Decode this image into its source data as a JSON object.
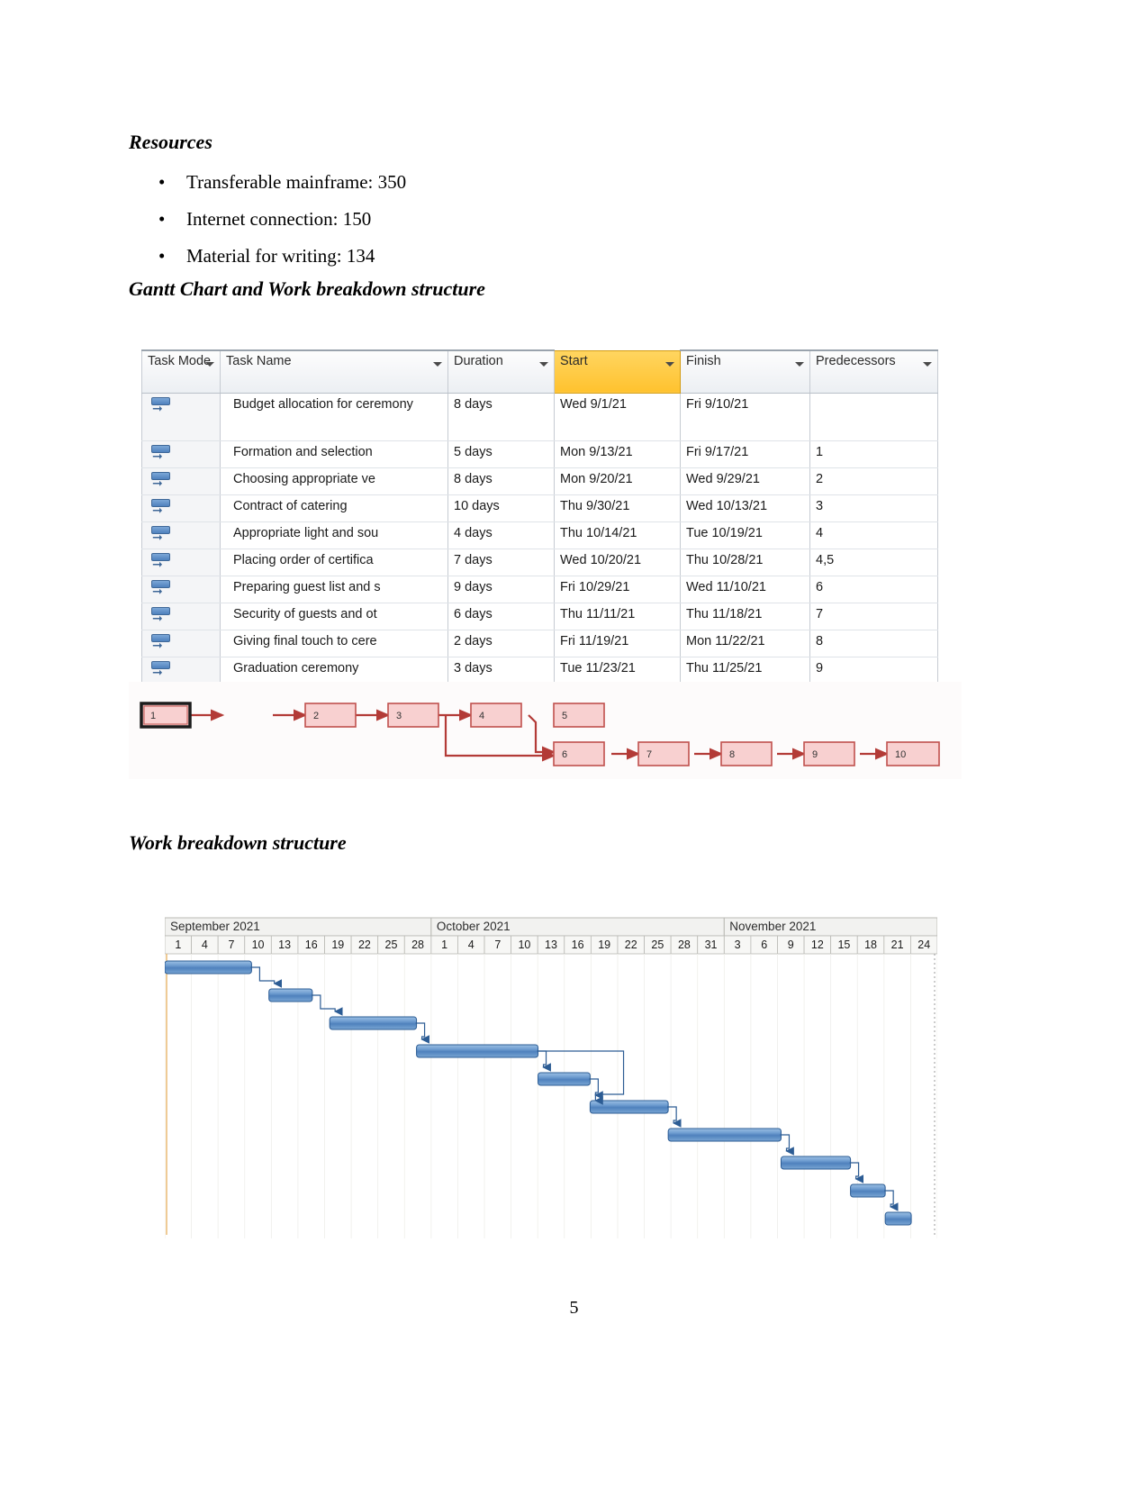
{
  "document": {
    "page_number": "5"
  },
  "sections": {
    "resources_heading": "Resources",
    "gantt_heading": "Gantt Chart and Work breakdown structure",
    "wbs_heading": "Work breakdown structure"
  },
  "resources": {
    "items": [
      "Transferable mainframe: 350",
      "Internet connection: 150",
      "Material for writing: 134"
    ]
  },
  "task_table": {
    "columns": [
      "Task Mode",
      "Task Name",
      "Duration",
      "Start",
      "Finish",
      "Predecessors"
    ],
    "highlighted_column": "Start",
    "highlight_color": "#ffc22e",
    "mode_icon": "auto-schedule-icon",
    "rows": [
      {
        "name": "Budget allocation for ceremony",
        "duration": "8 days",
        "start": "Wed 9/1/21",
        "finish": "Fri 9/10/21",
        "predecessors": ""
      },
      {
        "name": "Formation and selection",
        "duration": "5 days",
        "start": "Mon 9/13/21",
        "finish": "Fri 9/17/21",
        "predecessors": "1"
      },
      {
        "name": "Choosing appropriate ve",
        "duration": "8 days",
        "start": "Mon 9/20/21",
        "finish": "Wed 9/29/21",
        "predecessors": "2"
      },
      {
        "name": "Contract of catering",
        "duration": "10 days",
        "start": "Thu 9/30/21",
        "finish": "Wed 10/13/21",
        "predecessors": "3"
      },
      {
        "name": "Appropriate light and sou",
        "duration": "4 days",
        "start": "Thu 10/14/21",
        "finish": "Tue 10/19/21",
        "predecessors": "4"
      },
      {
        "name": "Placing order of certifica",
        "duration": "7 days",
        "start": "Wed 10/20/21",
        "finish": "Thu 10/28/21",
        "predecessors": "4,5"
      },
      {
        "name": "Preparing guest list and s",
        "duration": "9 days",
        "start": "Fri 10/29/21",
        "finish": "Wed 11/10/21",
        "predecessors": "6"
      },
      {
        "name": "Security of guests and ot",
        "duration": "6 days",
        "start": "Thu 11/11/21",
        "finish": "Thu 11/18/21",
        "predecessors": "7"
      },
      {
        "name": "Giving final touch to cere",
        "duration": "2 days",
        "start": "Fri 11/19/21",
        "finish": "Mon 11/22/21",
        "predecessors": "8"
      },
      {
        "name": "Graduation ceremony",
        "duration": "3 days",
        "start": "Tue 11/23/21",
        "finish": "Thu 11/25/21",
        "predecessors": "9"
      }
    ]
  },
  "network_diagram": {
    "node_fill": "#f8d0d0",
    "node_border": "#c0504d",
    "selected_node": "1",
    "top_row": [
      "1",
      "2",
      "3",
      "4",
      "5"
    ],
    "bottom_row": [
      "6",
      "7",
      "8",
      "9",
      "10"
    ],
    "links": [
      "1>2",
      "2>3",
      "3>4",
      "4>5",
      "4>6",
      "5>6",
      "6>7",
      "7>8",
      "8>9",
      "9>10"
    ]
  },
  "chart_data": {
    "type": "bar",
    "title": "Work breakdown structure",
    "xlabel": "",
    "ylabel": "",
    "orientation": "horizontal-timeline",
    "bar_fill": "#4f81bd",
    "months": [
      {
        "label": "September 2021",
        "ticks": [
          "1",
          "4",
          "7",
          "10",
          "13",
          "16",
          "19",
          "22",
          "25",
          "28"
        ]
      },
      {
        "label": "October 2021",
        "ticks": [
          "1",
          "4",
          "7",
          "10",
          "13",
          "16",
          "19",
          "22",
          "25",
          "28",
          "31"
        ]
      },
      {
        "label": "November 2021",
        "ticks": [
          "3",
          "6",
          "9",
          "12",
          "15",
          "18",
          "21",
          "24"
        ]
      }
    ],
    "axis_start": "2021-09-01",
    "axis_end": "2021-11-25",
    "categories": [
      "Budget allocation for ceremony",
      "Formation and selection",
      "Choosing appropriate ve",
      "Contract of catering",
      "Appropriate light and sou",
      "Placing order of certifica",
      "Preparing guest list and s",
      "Security of guests and ot",
      "Giving final touch to cere",
      "Graduation ceremony"
    ],
    "bars": [
      {
        "task": "Budget allocation for ceremony",
        "start": "2021-09-01",
        "finish": "2021-09-10",
        "duration_days": 8
      },
      {
        "task": "Formation and selection",
        "start": "2021-09-13",
        "finish": "2021-09-17",
        "duration_days": 5
      },
      {
        "task": "Choosing appropriate ve",
        "start": "2021-09-20",
        "finish": "2021-09-29",
        "duration_days": 8
      },
      {
        "task": "Contract of catering",
        "start": "2021-09-30",
        "finish": "2021-10-13",
        "duration_days": 10
      },
      {
        "task": "Appropriate light and sou",
        "start": "2021-10-14",
        "finish": "2021-10-19",
        "duration_days": 4
      },
      {
        "task": "Placing order of certifica",
        "start": "2021-10-20",
        "finish": "2021-10-28",
        "duration_days": 7
      },
      {
        "task": "Preparing guest list and s",
        "start": "2021-10-29",
        "finish": "2021-11-10",
        "duration_days": 9
      },
      {
        "task": "Security of guests and ot",
        "start": "2021-11-11",
        "finish": "2021-11-18",
        "duration_days": 6
      },
      {
        "task": "Giving final touch to cere",
        "start": "2021-11-19",
        "finish": "2021-11-22",
        "duration_days": 2
      },
      {
        "task": "Graduation ceremony",
        "start": "2021-11-23",
        "finish": "2021-11-25",
        "duration_days": 3
      }
    ],
    "grid": true,
    "legend": []
  }
}
